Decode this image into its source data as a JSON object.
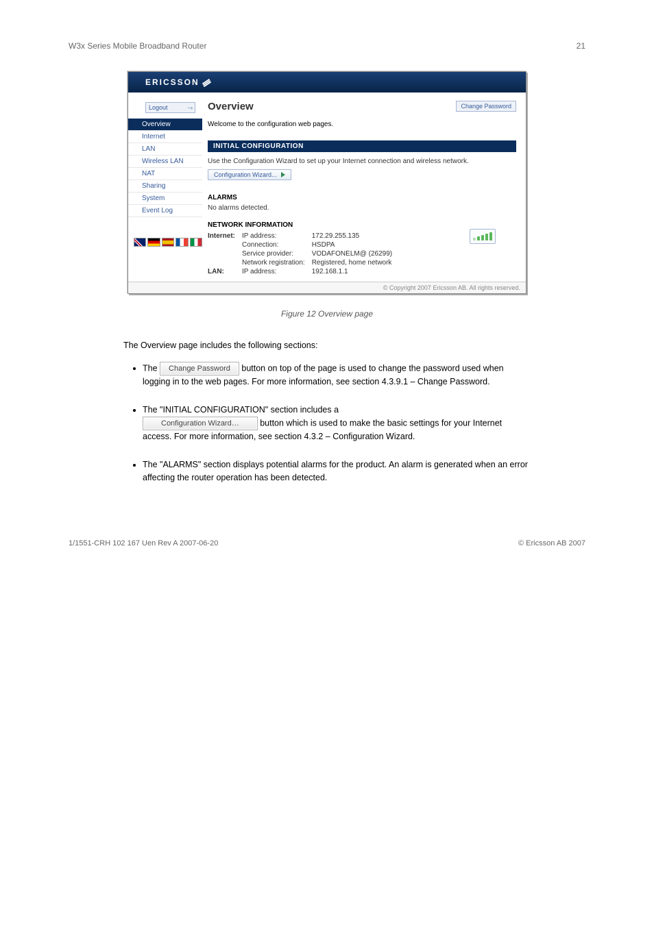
{
  "doc": {
    "header_title": "W3x Series Mobile Broadband Router",
    "header_number": "21",
    "footer_left": "1/1551-CRH 102 167 Uen Rev A 2007-06-20",
    "footer_right": "© Ericsson AB 2007"
  },
  "app": {
    "brand": "ERICSSON",
    "logout_label": "Logout",
    "change_password_label": "Change Password",
    "nav": [
      {
        "label": "Overview",
        "active": true
      },
      {
        "label": "Internet",
        "active": false
      },
      {
        "label": "LAN",
        "active": false
      },
      {
        "label": "Wireless LAN",
        "active": false
      },
      {
        "label": "NAT",
        "active": false
      },
      {
        "label": "Sharing",
        "active": false
      },
      {
        "label": "System",
        "active": false
      },
      {
        "label": "Event Log",
        "active": false
      }
    ],
    "page_title": "Overview",
    "welcome": "Welcome to the configuration web pages.",
    "initial_config_header": "INITIAL CONFIGURATION",
    "initial_config_text": "Use the Configuration Wizard to set up your Internet connection and wireless network.",
    "wizard_button": "Configuration Wizard...",
    "alarms_header": "ALARMS",
    "alarms_text": "No alarms detected.",
    "netinfo_header": "NETWORK INFORMATION",
    "netinfo": {
      "internet_label": "Internet:",
      "ip_label": "IP address:",
      "ip_value": "172.29.255.135",
      "conn_label": "Connection:",
      "conn_value": "HSDPA",
      "provider_label": "Service provider:",
      "provider_value": "VODAFONELM@ (26299)",
      "reg_label": "Network registration:",
      "reg_value": "Registered, home network",
      "lan_label": "LAN:",
      "lan_ip_label": "IP address:",
      "lan_ip_value": "192.168.1.1"
    },
    "copyright": "© Copyright 2007 Ericsson AB. All rights reserved."
  },
  "figure_caption": "Figure 12   Overview page",
  "intro_text": "The Overview page includes the following sections:",
  "bullets": [
    {
      "pre": "The ",
      "btn": "Change Password",
      "post": " button on top of the page is used to change the password used when logging in to the web pages. For more information, see section 4.3.9.1 – Change Password."
    },
    {
      "pre": "The \"INITIAL CONFIGURATION\" section includes a ",
      "btn": "",
      "post": ""
    },
    {
      "pre": "",
      "btn": "Configuration Wizard…",
      "post": " button which is used to make the basic settings for your Internet access. For more information, see section 4.3.2 – Configuration Wizard."
    },
    {
      "pre": "The \"ALARMS\" section displays potential alarms for the product. An alarm is generated when an error affecting the router operation has been detected.",
      "btn": "",
      "post": ""
    }
  ]
}
